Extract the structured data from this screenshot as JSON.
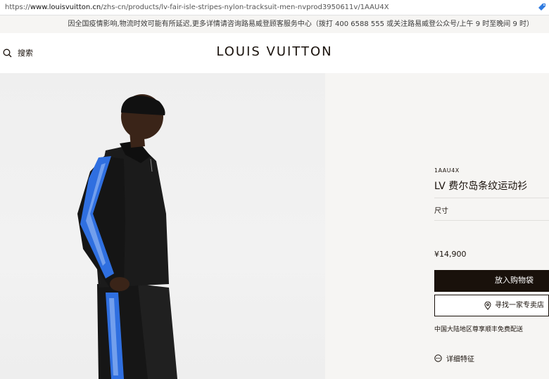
{
  "browser": {
    "url_prefix": "https://",
    "url_host": "www.louisvuitton.cn",
    "url_path": "/zhs-cn/products/lv-fair-isle-stripes-nylon-tracksuit-men-nvprod3950611v/1AAU4X"
  },
  "notice": {
    "text": "因全国疫情影响,物流时效可能有所延迟,更多详情请咨询路易威登顾客服务中心（拨打 400 6588 555 或关注路易威登公众号/上午 9 时至晚间 9 时）"
  },
  "header": {
    "search_label": "搜索",
    "logo": "LOUIS VUITTON"
  },
  "product": {
    "sku": "1AAU4X",
    "title": "LV 费尔岛条纹运动衫",
    "size_label": "尺寸",
    "price": "¥14,900",
    "add_to_bag": "放入购物袋",
    "find_store": "寻找一家专卖店",
    "shipping_note": "中国大陆地区尊享顺丰免费配送",
    "details_label": "详细特征"
  },
  "colors": {
    "accent_dark": "#19110b",
    "panel_bg": "#f6f5f3",
    "stripe_blue": "#2f6fe0"
  }
}
